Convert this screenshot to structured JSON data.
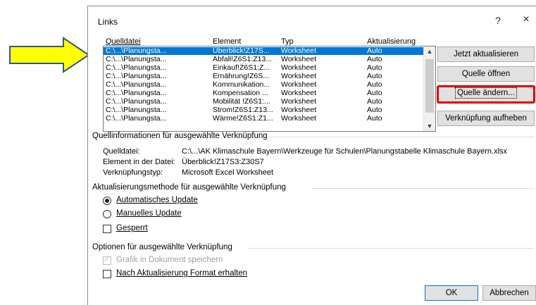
{
  "dialog": {
    "title": "Links",
    "help": "?",
    "close": "×"
  },
  "columns": {
    "source": "Quelldatei",
    "element": "Element",
    "type": "Typ",
    "update": "Aktualisierung"
  },
  "rows": [
    {
      "source": "C:\\...\\Planungsta...",
      "element": "Überblick!Z17S...",
      "type": "Worksheet",
      "update": "Auto"
    },
    {
      "source": "C:\\...\\Planungsta...",
      "element": "Abfall!Z6S1:Z13...",
      "type": "Worksheet",
      "update": "Auto"
    },
    {
      "source": "C:\\...\\Planungsta...",
      "element": "Einkauf!Z6S1:Z...",
      "type": "Worksheet",
      "update": "Auto"
    },
    {
      "source": "C:\\...\\Planungsta...",
      "element": "Ernährung!Z6S...",
      "type": "Worksheet",
      "update": "Auto"
    },
    {
      "source": "C:\\...\\Planungsta...",
      "element": "Kommunikation...",
      "type": "Worksheet",
      "update": "Auto"
    },
    {
      "source": "C:\\...\\Planungsta...",
      "element": "Kompensation ...",
      "type": "Worksheet",
      "update": "Auto"
    },
    {
      "source": "C:\\...\\Planungsta...",
      "element": "Mobilität !Z6S1:...",
      "type": "Worksheet",
      "update": "Auto"
    },
    {
      "source": "C:\\...\\Planungsta...",
      "element": "Strom!Z6S1:Z13...",
      "type": "Worksheet",
      "update": "Auto"
    },
    {
      "source": "C:\\...\\Planungsta...",
      "element": "Wärme!Z6S1:Z1...",
      "type": "Worksheet",
      "update": "Auto"
    }
  ],
  "buttons": {
    "update_now": "Jetzt aktualisieren",
    "open_source": "Quelle öffnen",
    "change_source": "Quelle ändern...",
    "break_link": "Verknüpfung aufheben",
    "ok": "OK",
    "cancel": "Abbrechen"
  },
  "info": {
    "group_title": "Quellinformationen für ausgewählte Verknüpfung",
    "source_label": "Quelldatei:",
    "source_value": "C:\\...\\AK Klimaschule Bayern\\Werkzeuge für Schulen\\Planungstabelle Klimaschule Bayern.xlsx",
    "element_label": "Element in der Datei:",
    "element_value": "Überblick!Z17S3:Z30S7",
    "type_label": "Verknüpfungstyp:",
    "type_value": "Microsoft Excel Worksheet"
  },
  "update_method": {
    "group_title": "Aktualisierungsmethode für ausgewählte Verknüpfung",
    "auto_label": "Automatisches Update",
    "manual_label": "Manuelles Update",
    "locked_label": "Gesperrt",
    "selected": "auto"
  },
  "options": {
    "group_title": "Optionen für ausgewählte Verknüpfung",
    "save_graphic_label": "Grafik in Dokument speichern",
    "keep_format_label": "Nach Aktualisierung Format erhalten"
  },
  "colors": {
    "arrow_fill": "#ffff00",
    "arrow_stroke": "#2f5597",
    "highlight": "#e00000",
    "selection": "#0078d7"
  }
}
